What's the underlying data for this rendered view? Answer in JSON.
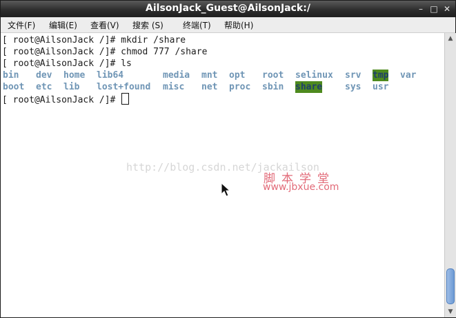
{
  "window": {
    "title": "AilsonJack_Guest@AilsonJack:/",
    "controls": {
      "minimize": "–",
      "maximize": "□",
      "close": "✕"
    }
  },
  "menubar": {
    "items": [
      "文件(F)",
      "编辑(E)",
      "查看(V)",
      "搜索 (S)",
      "终端(T)",
      "帮助(H)"
    ]
  },
  "terminal": {
    "lines": [
      "[ root@AilsonJack /]# mkdir /share",
      "[ root@AilsonJack /]# chmod 777 /share",
      "[ root@AilsonJack /]# ls"
    ],
    "ls_row1": [
      "bin",
      "dev",
      "home",
      "lib64",
      "media",
      "mnt",
      "opt",
      "root",
      "selinux",
      "srv",
      "tmp",
      "var"
    ],
    "ls_row2": [
      "boot",
      "etc",
      "lib",
      "lost+found",
      "misc",
      "net",
      "proc",
      "sbin",
      "share",
      "sys",
      "usr"
    ],
    "highlighted_dirs": [
      "tmp",
      "share"
    ],
    "prompt": "[ root@AilsonJack /]#"
  },
  "watermarks": {
    "blog": "http://blog.csdn.net/jackailson",
    "site_cn": "脚本学堂",
    "site_url": "www.jbxue.com"
  },
  "colors": {
    "dir_text": "#6f95b5",
    "highlight_bg": "#4e8a1e",
    "watermark_red": "#e26a78"
  },
  "scrollbar": {
    "up_icon": "arrow-up-icon",
    "down_icon": "arrow-down-icon"
  }
}
